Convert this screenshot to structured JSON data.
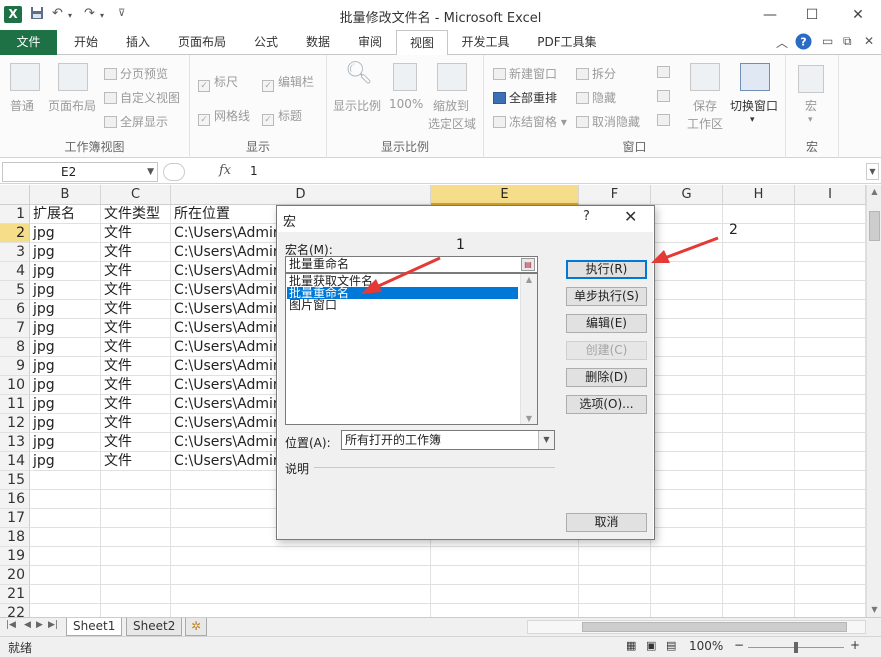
{
  "window": {
    "title": "批量修改文件名 - Microsoft Excel",
    "app_icon": "X",
    "qat": [
      "save-icon",
      "undo-icon",
      "redo-icon",
      "customize-qat-icon"
    ],
    "controls": [
      "—",
      "☐",
      "✕"
    ]
  },
  "ribbon": {
    "tabs": [
      {
        "label": "文件",
        "kind": "file"
      },
      {
        "label": "开始"
      },
      {
        "label": "插入"
      },
      {
        "label": "页面布局"
      },
      {
        "label": "公式"
      },
      {
        "label": "数据"
      },
      {
        "label": "审阅"
      },
      {
        "label": "视图",
        "active": true
      },
      {
        "label": "开发工具"
      },
      {
        "label": "PDF工具集"
      }
    ],
    "groups": {
      "workbook_views": {
        "label": "工作簿视图",
        "normal": "普通",
        "page_layout": "页面布局",
        "page_break": "分页预览",
        "custom_views": "自定义视图",
        "full_screen": "全屏显示"
      },
      "show": {
        "label": "显示",
        "ruler": "标尺",
        "formula_bar": "编辑栏",
        "gridlines": "网格线",
        "headings": "标题"
      },
      "zoom": {
        "label": "显示比例",
        "zoom": "显示比例",
        "hundred": "100%",
        "zoom_to_selection_1": "缩放到",
        "zoom_to_selection_2": "选定区域"
      },
      "window": {
        "label": "窗口",
        "new_window": "新建窗口",
        "arrange_all": "全部重排",
        "freeze_panes": "冻结窗格",
        "split": "拆分",
        "hide": "隐藏",
        "unhide": "取消隐藏",
        "save_workspace_1": "保存",
        "save_workspace_2": "工作区",
        "switch_windows": "切换窗口"
      },
      "macros": {
        "label": "宏",
        "macros": "宏"
      }
    }
  },
  "formula_bar": {
    "name_box": "E2",
    "fx": "fx",
    "value": "1"
  },
  "sheet": {
    "columns": [
      "B",
      "C",
      "D",
      "E",
      "F",
      "G",
      "H",
      "I"
    ],
    "selected_column": "E",
    "row_numbers": [
      "1",
      "2",
      "3",
      "4",
      "5",
      "6",
      "7",
      "8",
      "9",
      "10",
      "11",
      "12",
      "13",
      "14",
      "15",
      "16",
      "17",
      "18",
      "19",
      "20",
      "21",
      "22"
    ],
    "selected_row": "2",
    "header": [
      "扩展名",
      "文件类型",
      "所在位置"
    ],
    "rows": [
      [
        "jpg",
        "文件",
        "C:\\Users\\Admin"
      ],
      [
        "jpg",
        "文件",
        "C:\\Users\\Admin"
      ],
      [
        "jpg",
        "文件",
        "C:\\Users\\Admin"
      ],
      [
        "jpg",
        "文件",
        "C:\\Users\\Admin"
      ],
      [
        "jpg",
        "文件",
        "C:\\Users\\Admin"
      ],
      [
        "jpg",
        "文件",
        "C:\\Users\\Admin"
      ],
      [
        "jpg",
        "文件",
        "C:\\Users\\Admin"
      ],
      [
        "jpg",
        "文件",
        "C:\\Users\\Admin"
      ],
      [
        "jpg",
        "文件",
        "C:\\Users\\Admin"
      ],
      [
        "jpg",
        "文件",
        "C:\\Users\\Admin"
      ],
      [
        "jpg",
        "文件",
        "C:\\Users\\Admin"
      ],
      [
        "jpg",
        "文件",
        "C:\\Users\\Admin"
      ],
      [
        "jpg",
        "文件",
        "C:\\Users\\Admin"
      ]
    ],
    "tabs": [
      "Sheet1",
      "Sheet2"
    ],
    "active_tab": "Sheet1"
  },
  "status_bar": {
    "ready": "就绪",
    "zoom": "100%",
    "minus": "−",
    "plus": "+"
  },
  "macro_dialog": {
    "title": "宏",
    "help": "?",
    "close": "✕",
    "name_label": "宏名(M):",
    "macro_name": "批量重命名",
    "macros": [
      "批量获取文件名",
      "批量重命名",
      "图片窗口"
    ],
    "selected_macro": "批量重命名",
    "buttons": {
      "run": "执行(R)",
      "step_into": "单步执行(S)",
      "edit": "编辑(E)",
      "create": "创建(C)",
      "delete": "删除(D)",
      "options": "选项(O)...",
      "cancel": "取消"
    },
    "location_label": "位置(A):",
    "location_value": "所有打开的工作簿",
    "description_label": "说明"
  },
  "annotations": {
    "step_1": "1",
    "step_2": "2",
    "arrow_color": "#e53935"
  },
  "colors": {
    "excel_green": "#1e7145",
    "selection_header": "#f6dd8a",
    "list_selection": "#0078d7"
  }
}
